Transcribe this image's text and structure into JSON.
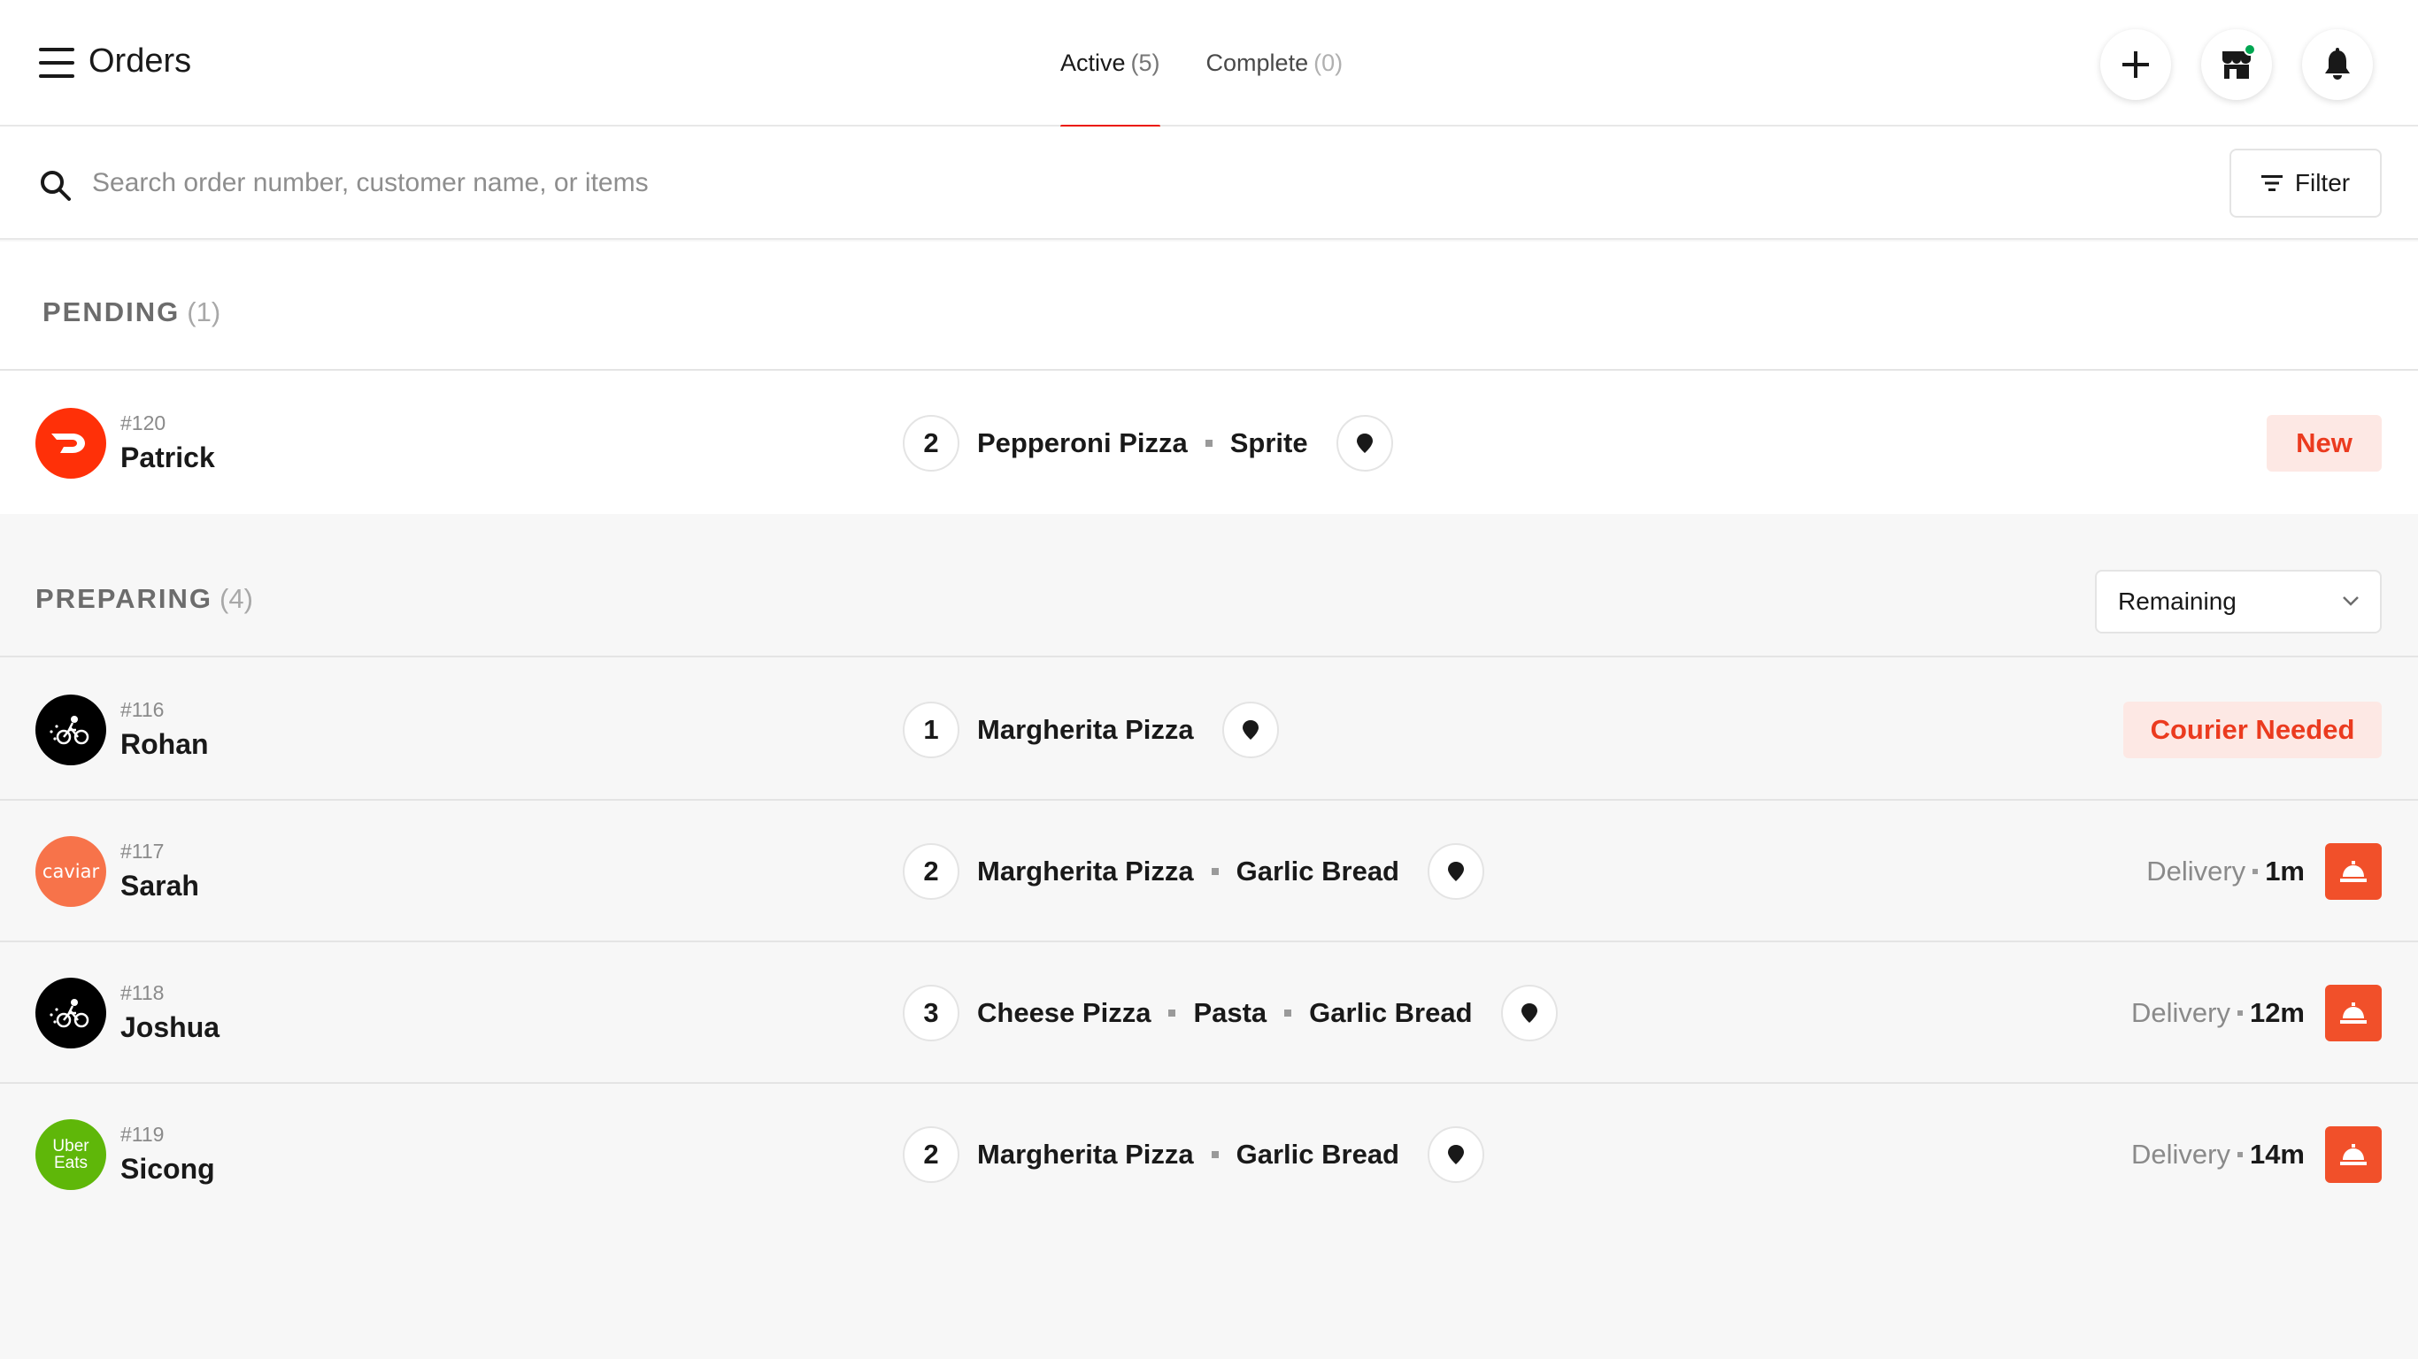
{
  "header": {
    "title": "Orders",
    "tabs": [
      {
        "label": "Active",
        "count": "(5)"
      },
      {
        "label": "Complete",
        "count": "(0)"
      }
    ]
  },
  "search": {
    "placeholder": "Search order number, customer name, or items",
    "filter_label": "Filter"
  },
  "sections": {
    "pending": {
      "title": "PENDING",
      "count": "(1)"
    },
    "preparing": {
      "title": "PREPARING",
      "count": "(4)",
      "sort_value": "Remaining"
    }
  },
  "avatars": {
    "caviar": "caviar",
    "ubereats_line1": "Uber",
    "ubereats_line2": "Eats"
  },
  "orders": [
    {
      "number": "#120",
      "customer": "Patrick",
      "qty": "2",
      "items": [
        "Pepperoni Pizza",
        "Sprite"
      ],
      "status": "New",
      "platform": "doordash"
    },
    {
      "number": "#116",
      "customer": "Rohan",
      "qty": "1",
      "items": [
        "Margherita Pizza"
      ],
      "status": "Courier Needed",
      "platform": "postmates"
    },
    {
      "number": "#117",
      "customer": "Sarah",
      "qty": "2",
      "items": [
        "Margherita Pizza",
        "Garlic Bread"
      ],
      "delivery_label": "Delivery",
      "delivery_time": "1m",
      "platform": "caviar"
    },
    {
      "number": "#118",
      "customer": "Joshua",
      "qty": "3",
      "items": [
        "Cheese Pizza",
        "Pasta",
        "Garlic Bread"
      ],
      "delivery_label": "Delivery",
      "delivery_time": "12m",
      "platform": "postmates"
    },
    {
      "number": "#119",
      "customer": "Sicong",
      "qty": "2",
      "items": [
        "Margherita Pizza",
        "Garlic Bread"
      ],
      "delivery_label": "Delivery",
      "delivery_time": "14m",
      "platform": "ubereats"
    }
  ],
  "colors": {
    "accent": "#eb1700",
    "doordash": "#ff3008",
    "caviar": "#f7734a",
    "ubereats": "#5fb709",
    "postmates": "#000000",
    "bell_button": "#f1502a",
    "badge_bg": "#fde8e4",
    "badge_text": "#eb3b1f"
  },
  "icons": {
    "menu": "hamburger-menu-icon",
    "add": "plus-icon",
    "store": "storefront-icon",
    "notifications": "bell-icon",
    "search": "search-icon",
    "filter": "filter-lines-icon",
    "pin": "location-pin-icon",
    "chevron": "chevron-down-icon",
    "ready": "service-bell-icon"
  }
}
